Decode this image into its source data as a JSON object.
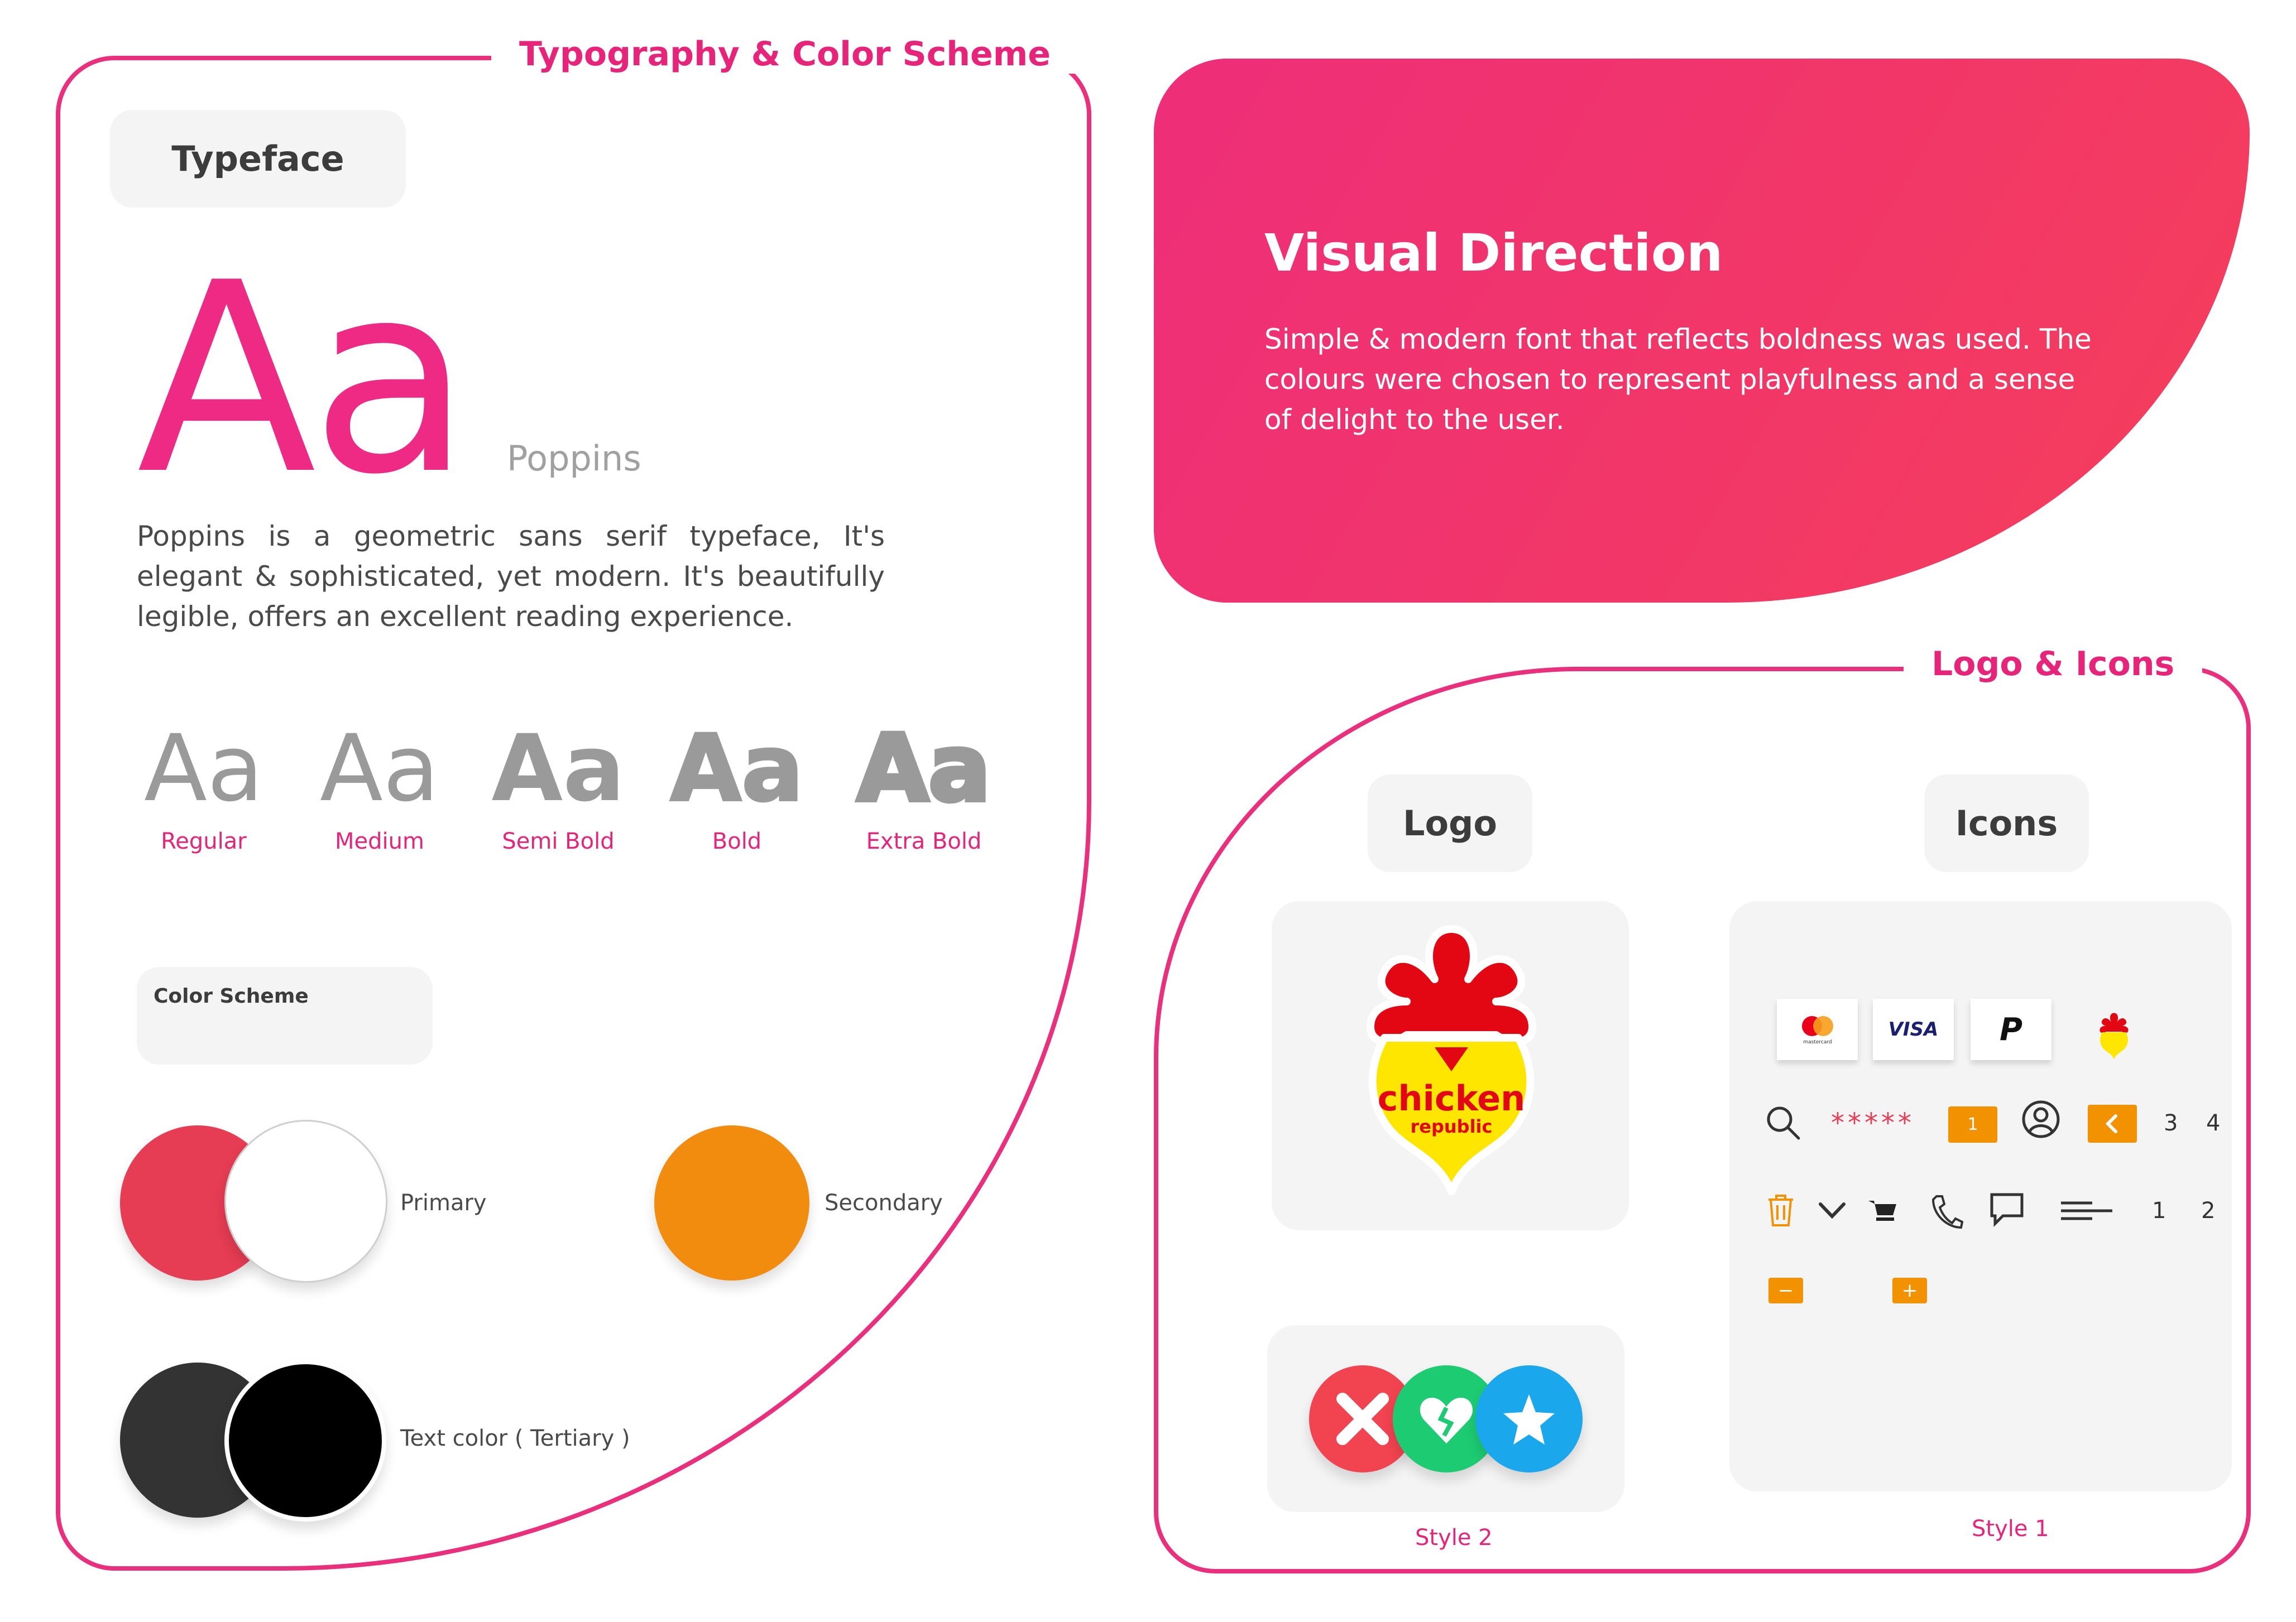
{
  "typography_section": {
    "title": "Typography & Color Scheme",
    "typeface_pill": "Typeface",
    "sample_glyphs": "Aa",
    "font_name": "Poppins",
    "description": "Poppins is a geometric sans serif typeface, It's elegant & sophisticated, yet modern. It's beautifully legible, offers an excellent reading experience.",
    "weights": [
      {
        "sample": "Aa",
        "label": "Regular"
      },
      {
        "sample": "Aa",
        "label": "Medium"
      },
      {
        "sample": "Aa",
        "label": "Semi Bold"
      },
      {
        "sample": "Aa",
        "label": "Bold"
      },
      {
        "sample": "Aa",
        "label": "Extra Bold"
      }
    ],
    "color_scheme_pill": "Color Scheme",
    "swatches": {
      "primary_label": "Primary",
      "primary_colors": [
        "#e63c54",
        "#ffffff"
      ],
      "secondary_label": "Secondary",
      "secondary_color": "#f28c0f",
      "tertiary_label": "Text color ( Tertiary )",
      "tertiary_colors": [
        "#333333",
        "#000000"
      ]
    }
  },
  "visual_direction": {
    "title": "Visual Direction",
    "body": "Simple & modern font that reflects boldness was used. The colours were chosen to represent playfulness and a sense of delight to the user."
  },
  "logo_icons_section": {
    "title": "Logo & Icons",
    "logo_pill": "Logo",
    "icons_pill": "Icons",
    "logo_text_main": "chicken",
    "logo_text_sub": "republic",
    "style2_label": "Style 2",
    "style1_label": "Style 1",
    "payment_icons": [
      "mastercard",
      "VISA",
      "P"
    ],
    "stars_text": "*****",
    "pagination_current": "1",
    "pagination_nums_a": [
      "3",
      "4"
    ],
    "pagination_nums_b": [
      "1",
      "2"
    ],
    "minus_label": "−",
    "plus_label": "+"
  },
  "colors": {
    "accent": "#e8237a",
    "hero_gradient": [
      "#ee2e79",
      "#f53e5a"
    ],
    "orange": "#f39200"
  }
}
